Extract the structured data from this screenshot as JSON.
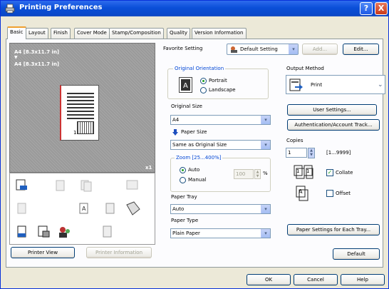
{
  "window": {
    "title": "Printing Preferences",
    "help_label": "?",
    "close_label": "X"
  },
  "tabs": [
    {
      "label": "Basic",
      "active": true
    },
    {
      "label": "Layout"
    },
    {
      "label": "Finish"
    },
    {
      "label": "Cover Mode"
    },
    {
      "label": "Stamp/Composition"
    },
    {
      "label": "Quality"
    },
    {
      "label": "Version Information"
    }
  ],
  "preview": {
    "size_line1": "A4 [8.3x11.7 in]",
    "arrow": "▼",
    "size_line2": "A4 [8.3x11.7 in]",
    "copies_badge": "x1",
    "page_number": "1"
  },
  "left_buttons": {
    "printer_view": "Printer View",
    "printer_information": "Printer Information"
  },
  "favorite": {
    "label": "Favorite Setting",
    "value": "Default Setting",
    "add_label": "Add...",
    "edit_label": "Edit..."
  },
  "orientation": {
    "group_label": "Original Orientation",
    "portrait": "Portrait",
    "landscape": "Landscape",
    "selected": "Portrait"
  },
  "original_size": {
    "label": "Original Size",
    "value": "A4"
  },
  "paper_size": {
    "label": "Paper Size",
    "value": "Same as Original Size"
  },
  "zoom": {
    "group_label": "Zoom [25...400%]",
    "auto": "Auto",
    "manual": "Manual",
    "value": "100",
    "unit": "%",
    "selected": "Auto"
  },
  "paper_tray": {
    "label": "Paper Tray",
    "value": "Auto"
  },
  "paper_type": {
    "label": "Paper Type",
    "value": "Plain Paper"
  },
  "output_method": {
    "label": "Output Method",
    "value": "Print"
  },
  "right_buttons": {
    "user_settings": "User Settings...",
    "authentication": "Authentication/Account Track...",
    "paper_settings": "Paper Settings for Each Tray...",
    "default": "Default"
  },
  "copies": {
    "label": "Copies",
    "value": "1",
    "range": "[1...9999]"
  },
  "collate": {
    "label": "Collate",
    "checked": true
  },
  "offset": {
    "label": "Offset",
    "checked": false
  },
  "dialog_buttons": {
    "ok": "OK",
    "cancel": "Cancel",
    "help": "Help"
  }
}
